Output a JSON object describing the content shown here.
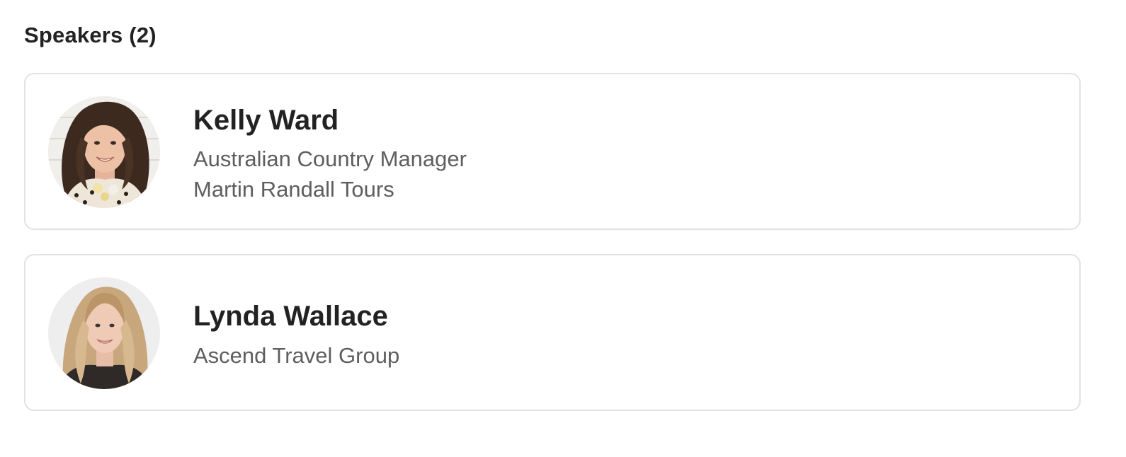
{
  "section": {
    "title": "Speakers (2)"
  },
  "speakers": [
    {
      "name": "Kelly Ward",
      "title": "Australian Country Manager",
      "company": "Martin Randall Tours",
      "avatar_icon": "person-photo-dark-hair"
    },
    {
      "name": "Lynda Wallace",
      "company": "Ascend Travel Group",
      "avatar_icon": "person-photo-blonde-hair"
    }
  ],
  "colors": {
    "card_border": "#e2e2e2",
    "name_text": "#222222",
    "secondary_text": "#5e5e5e"
  }
}
